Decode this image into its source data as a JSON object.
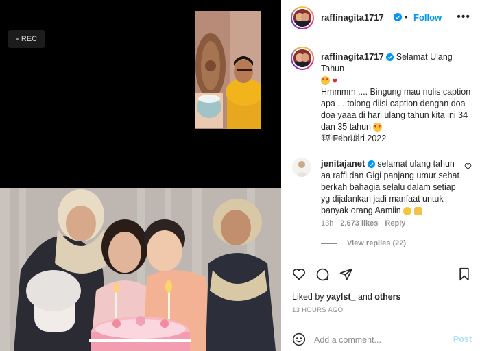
{
  "video": {
    "rec_label": "REC"
  },
  "post": {
    "author": "raffinagita1717",
    "follow_label": "Follow",
    "more_label": "•••",
    "caption": {
      "author": "raffinagita1717",
      "line1": "Selamat Ulang Tahun",
      "body": "Hmmmm .... Bingung mau nulis caption apa ... tolong diisi caption dengan doa doa yaaa di hari ulang tahun kita ini 34 dan 35 tahun",
      "date": "17 Februari 2022",
      "edited": "Edited · 13h"
    },
    "comment": {
      "author": "jenitajanet",
      "text": "selamat ulang tahun aa raffi dan Gigi panjang umur sehat berkah bahagia selalu dalam setiap yg dijalankan jadi manfaat untuk banyak orang Aamiin",
      "time": "13h",
      "likes": "2,673 likes",
      "reply_label": "Reply",
      "view_replies": "View replies (22)"
    },
    "liked_by_prefix": "Liked by",
    "liked_by_user": "yaylst_",
    "liked_by_and": "and",
    "liked_by_others": "others",
    "timestamp": "13 HOURS AGO",
    "add_comment_placeholder": "Add a comment...",
    "post_label": "Post"
  },
  "colors": {
    "accent": "#0095f6",
    "verified": "#0095f6",
    "text": "#262626",
    "muted": "#8e8e8e"
  },
  "icons": [
    "verified-badge-icon",
    "heart-icon",
    "comment-icon",
    "share-icon",
    "bookmark-icon",
    "emoji-icon",
    "more-icon"
  ]
}
